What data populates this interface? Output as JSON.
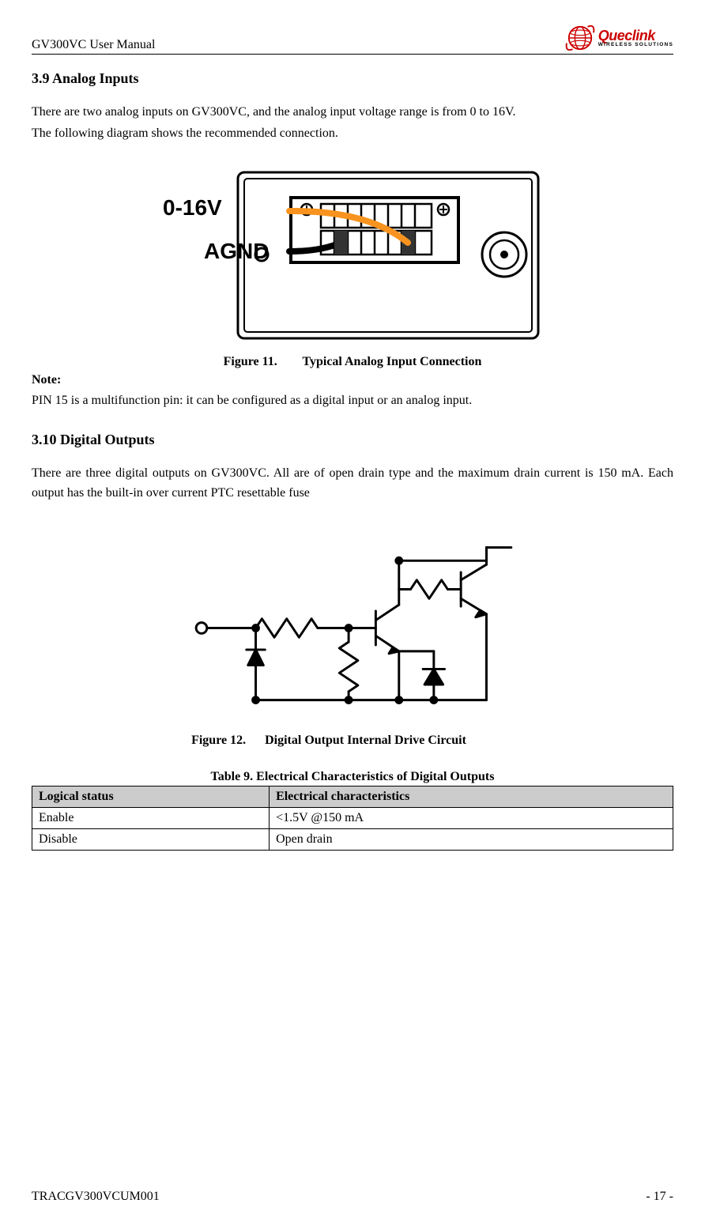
{
  "header": {
    "title": "GV300VC User Manual",
    "logo": {
      "name": "Queclink",
      "tagline": "WIRELESS SOLUTIONS"
    }
  },
  "section39": {
    "heading": "3.9  Analog Inputs",
    "p1": "There are two analog inputs on GV300VC, and the analog input voltage range is from 0 to 16V.",
    "p2": "The following diagram shows the recommended connection.",
    "figure": {
      "voltage_label": "0-16V",
      "agnd_label": "AGND",
      "caption_num": "Figure 11.",
      "caption_text": "Typical Analog Input Connection"
    },
    "note_label": "Note:",
    "note_text": "PIN 15 is a multifunction pin: it can be configured as a digital input or an analog input."
  },
  "section310": {
    "heading": "3.10    Digital Outputs",
    "p1": "There are three digital outputs on GV300VC. All are of open drain type and the maximum drain current is 150 mA. Each output has the built-in over current PTC resettable fuse",
    "figure": {
      "caption_num": "Figure 12.",
      "caption_text": "Digital Output Internal Drive Circuit"
    },
    "table": {
      "caption": "Table 9. Electrical Characteristics of Digital Outputs",
      "headers": [
        "Logical status",
        "Electrical characteristics"
      ],
      "rows": [
        [
          "Enable",
          "<1.5V @150 mA"
        ],
        [
          "Disable",
          "Open drain"
        ]
      ]
    }
  },
  "footer": {
    "doc_id": "TRACGV300VCUM001",
    "page": "- 17 -"
  }
}
